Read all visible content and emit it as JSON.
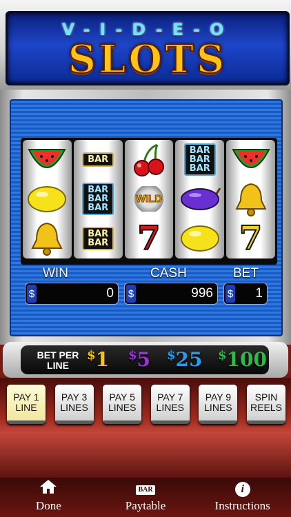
{
  "title": {
    "line1": "V-I-D-E-O",
    "line2": "SLOTS"
  },
  "reels": [
    [
      {
        "type": "watermelon",
        "icon": "watermelon-icon"
      },
      {
        "type": "lemon",
        "icon": "lemon-icon"
      },
      {
        "type": "bell",
        "icon": "bell-icon"
      }
    ],
    [
      {
        "type": "bar",
        "label": "BAR"
      },
      {
        "type": "bar3",
        "label": "BAR\nBAR\nBAR"
      },
      {
        "type": "bar2",
        "label": "BAR\nBAR"
      }
    ],
    [
      {
        "type": "cherries",
        "icon": "cherries-icon"
      },
      {
        "type": "wild",
        "label": "WILD"
      },
      {
        "type": "seven",
        "label": "7",
        "color": "#d61a1a"
      }
    ],
    [
      {
        "type": "bar3",
        "label": "BAR\nBAR\nBAR"
      },
      {
        "type": "plum",
        "icon": "plum-icon"
      },
      {
        "type": "lemon",
        "icon": "lemon-icon"
      }
    ],
    [
      {
        "type": "watermelon",
        "icon": "watermelon-icon"
      },
      {
        "type": "bell",
        "icon": "bell-icon"
      },
      {
        "type": "seven",
        "label": "7",
        "color": "#f2d21a"
      }
    ]
  ],
  "meters": {
    "win_label": "WIN",
    "win_currency": "$",
    "win_value": "0",
    "cash_label": "CASH",
    "cash_currency": "$",
    "cash_value": "996",
    "bet_label": "BET",
    "bet_currency": "$",
    "bet_value": "1"
  },
  "bet_per_line": {
    "label": "BET PER LINE",
    "options": [
      {
        "currency": "$",
        "amount": "1",
        "color": "#f3c21a"
      },
      {
        "currency": "$",
        "amount": "5",
        "color": "#9a34d6"
      },
      {
        "currency": "$",
        "amount": "25",
        "color": "#2a9be8"
      },
      {
        "currency": "$",
        "amount": "100",
        "color": "#2fb84a"
      }
    ]
  },
  "buttons": [
    {
      "label": "PAY 1\nLINE",
      "active": true
    },
    {
      "label": "PAY 3\nLINES"
    },
    {
      "label": "PAY 5\nLINES"
    },
    {
      "label": "PAY 7\nLINES"
    },
    {
      "label": "PAY 9\nLINES"
    },
    {
      "label": "SPIN\nREELS"
    }
  ],
  "tabs": [
    {
      "label": "Done",
      "icon": "home-icon"
    },
    {
      "label": "Paytable",
      "icon": "bar-icon",
      "icon_text": "BAR"
    },
    {
      "label": "Instructions",
      "icon": "info-icon",
      "icon_text": "i"
    }
  ]
}
